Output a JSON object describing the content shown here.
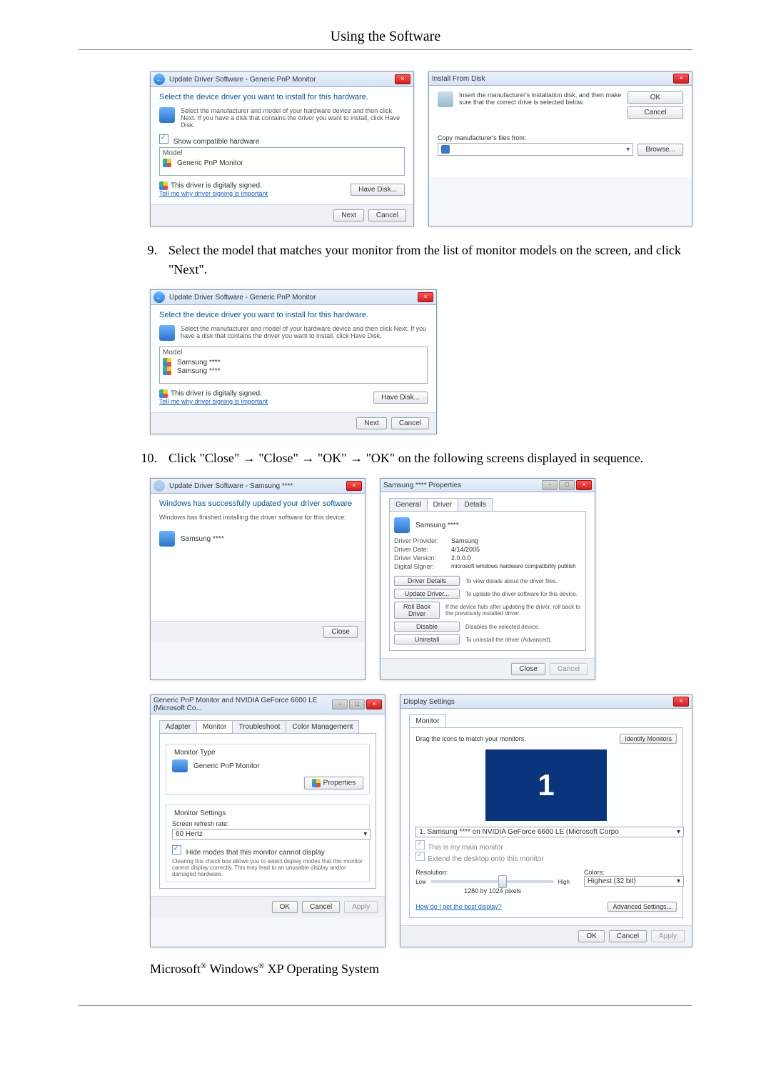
{
  "page": {
    "title": "Using the Software"
  },
  "steps": {
    "s9_num": "9.",
    "s9_text": "Select the model that matches your monitor from the list of monitor models on the screen, and click \"Next\".",
    "s10_num": "10.",
    "s10_text": "Click \"Close\" → \"Close\" → \"OK\" → \"OK\" on the following screens displayed in sequence."
  },
  "os_line": {
    "pre": "Microsoft",
    "r1": "®",
    "mid": " Windows",
    "r2": "®",
    "tail": " XP Operating System"
  },
  "driverWin": {
    "title": "Update Driver Software - Generic PnP Monitor",
    "heading": "Select the device driver you want to install for this hardware.",
    "sub": "Select the manufacturer and model of your hardware device and then click Next. If you have a disk that contains the driver you want to install, click Have Disk.",
    "compat_label": "Show compatible hardware",
    "list_header": "Model",
    "list_item": "Generic PnP Monitor",
    "signed": "This driver is digitally signed.",
    "tell": "Tell me why driver signing is important",
    "have_disk": "Have Disk...",
    "next": "Next",
    "cancel": "Cancel"
  },
  "ifd": {
    "title": "Install From Disk",
    "text": "Insert the manufacturer's installation disk, and then make sure that the correct drive is selected below.",
    "ok": "OK",
    "cancel": "Cancel",
    "copy_label": "Copy manufacturer's files from:",
    "browse": "Browse..."
  },
  "modelWin": {
    "title": "Update Driver Software - Generic PnP Monitor",
    "heading": "Select the device driver you want to install for this hardware.",
    "sub": "Select the manufacturer and model of your hardware device and then click Next. If you have a disk that contains the driver you want to install, click Have Disk.",
    "list_header": "Model",
    "item1": "Samsung ****",
    "item2": "Samsung ****",
    "signed": "This driver is digitally signed.",
    "tell": "Tell me why driver signing is important",
    "have_disk": "Have Disk...",
    "next": "Next",
    "cancel": "Cancel"
  },
  "successWin": {
    "title": "Update Driver Software - Samsung ****",
    "heading": "Windows has successfully updated your driver software",
    "sub": "Windows has finished installing the driver software for this device:",
    "device": "Samsung ****",
    "close": "Close"
  },
  "props": {
    "title": "Samsung **** Properties",
    "tabs": {
      "general": "General",
      "driver": "Driver",
      "details": "Details"
    },
    "device": "Samsung ****",
    "rows": {
      "provider_k": "Driver Provider:",
      "provider_v": "Samsung",
      "date_k": "Driver Date:",
      "date_v": "4/14/2005",
      "version_k": "Driver Version:",
      "version_v": "2.0.0.0",
      "signer_k": "Digital Signer:",
      "signer_v": "microsoft windows hardware compatibility publish"
    },
    "btns": {
      "details": "Driver Details",
      "details_d": "To view details about the driver files.",
      "update": "Update Driver...",
      "update_d": "To update the driver software for this device.",
      "rollback": "Roll Back Driver",
      "rollback_d": "If the device fails after updating the driver, roll back to the previously installed driver.",
      "disable": "Disable",
      "disable_d": "Disables the selected device.",
      "uninstall": "Uninstall",
      "uninstall_d": "To uninstall the driver (Advanced)."
    },
    "close": "Close",
    "cancel": "Cancel"
  },
  "genprop": {
    "title": "Generic PnP Monitor and NVIDIA GeForce 6600 LE (Microsoft Co...",
    "tabs": {
      "adapter": "Adapter",
      "monitor": "Monitor",
      "trouble": "Troubleshoot",
      "color": "Color Management"
    },
    "mtype_title": "Monitor Type",
    "mtype_value": "Generic PnP Monitor",
    "properties_btn": "Properties",
    "msettings_title": "Monitor Settings",
    "refresh_label": "Screen refresh rate:",
    "refresh_value": "60 Hertz",
    "hide_label": "Hide modes that this monitor cannot display",
    "hide_desc": "Clearing this check box allows you to select display modes that this monitor cannot display correctly. This may lead to an unusable display and/or damaged hardware.",
    "ok": "OK",
    "cancel": "Cancel",
    "apply": "Apply"
  },
  "disp": {
    "title": "Display Settings",
    "tab": "Monitor",
    "drag": "Drag the icons to match your monitors.",
    "identify": "Identify Monitors",
    "preview_num": "1",
    "combo": "1. Samsung **** on NVIDIA GeForce 6600 LE (Microsoft Corpo",
    "main_cb": "This is my main monitor",
    "extend_cb": "Extend the desktop onto this monitor",
    "res_label": "Resolution:",
    "low": "Low",
    "high": "High",
    "res_value": "1280 by 1024 pixels",
    "colors_label": "Colors:",
    "colors_value": "Highest (32 bit)",
    "best_link": "How do I get the best display?",
    "adv": "Advanced Settings...",
    "ok": "OK",
    "cancel": "Cancel",
    "apply": "Apply"
  }
}
